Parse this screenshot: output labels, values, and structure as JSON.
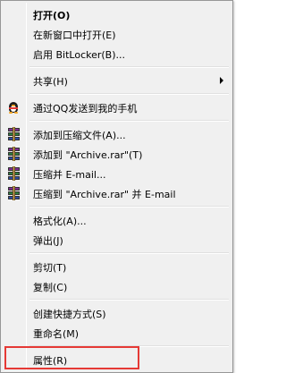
{
  "menu": {
    "items": [
      {
        "label": "打开(O)"
      },
      {
        "label": "在新窗口中打开(E)"
      },
      {
        "label": "启用 BitLocker(B)..."
      },
      {
        "label": "共享(H)"
      },
      {
        "label": "通过QQ发送到我的手机",
        "icon": "qq-penguin-icon"
      },
      {
        "label": "添加到压缩文件(A)...",
        "icon": "winrar-icon"
      },
      {
        "label": "添加到 \"Archive.rar\"(T)",
        "icon": "winrar-icon"
      },
      {
        "label": "压缩并 E-mail...",
        "icon": "winrar-icon"
      },
      {
        "label": "压缩到 \"Archive.rar\" 并 E-mail",
        "icon": "winrar-icon"
      },
      {
        "label": "格式化(A)..."
      },
      {
        "label": "弹出(J)"
      },
      {
        "label": "剪切(T)"
      },
      {
        "label": "复制(C)"
      },
      {
        "label": "创建快捷方式(S)"
      },
      {
        "label": "重命名(M)"
      },
      {
        "label": "属性(R)"
      }
    ]
  },
  "colors": {
    "menu_background": "#f0f0f0",
    "highlight_box": "#e53935"
  }
}
